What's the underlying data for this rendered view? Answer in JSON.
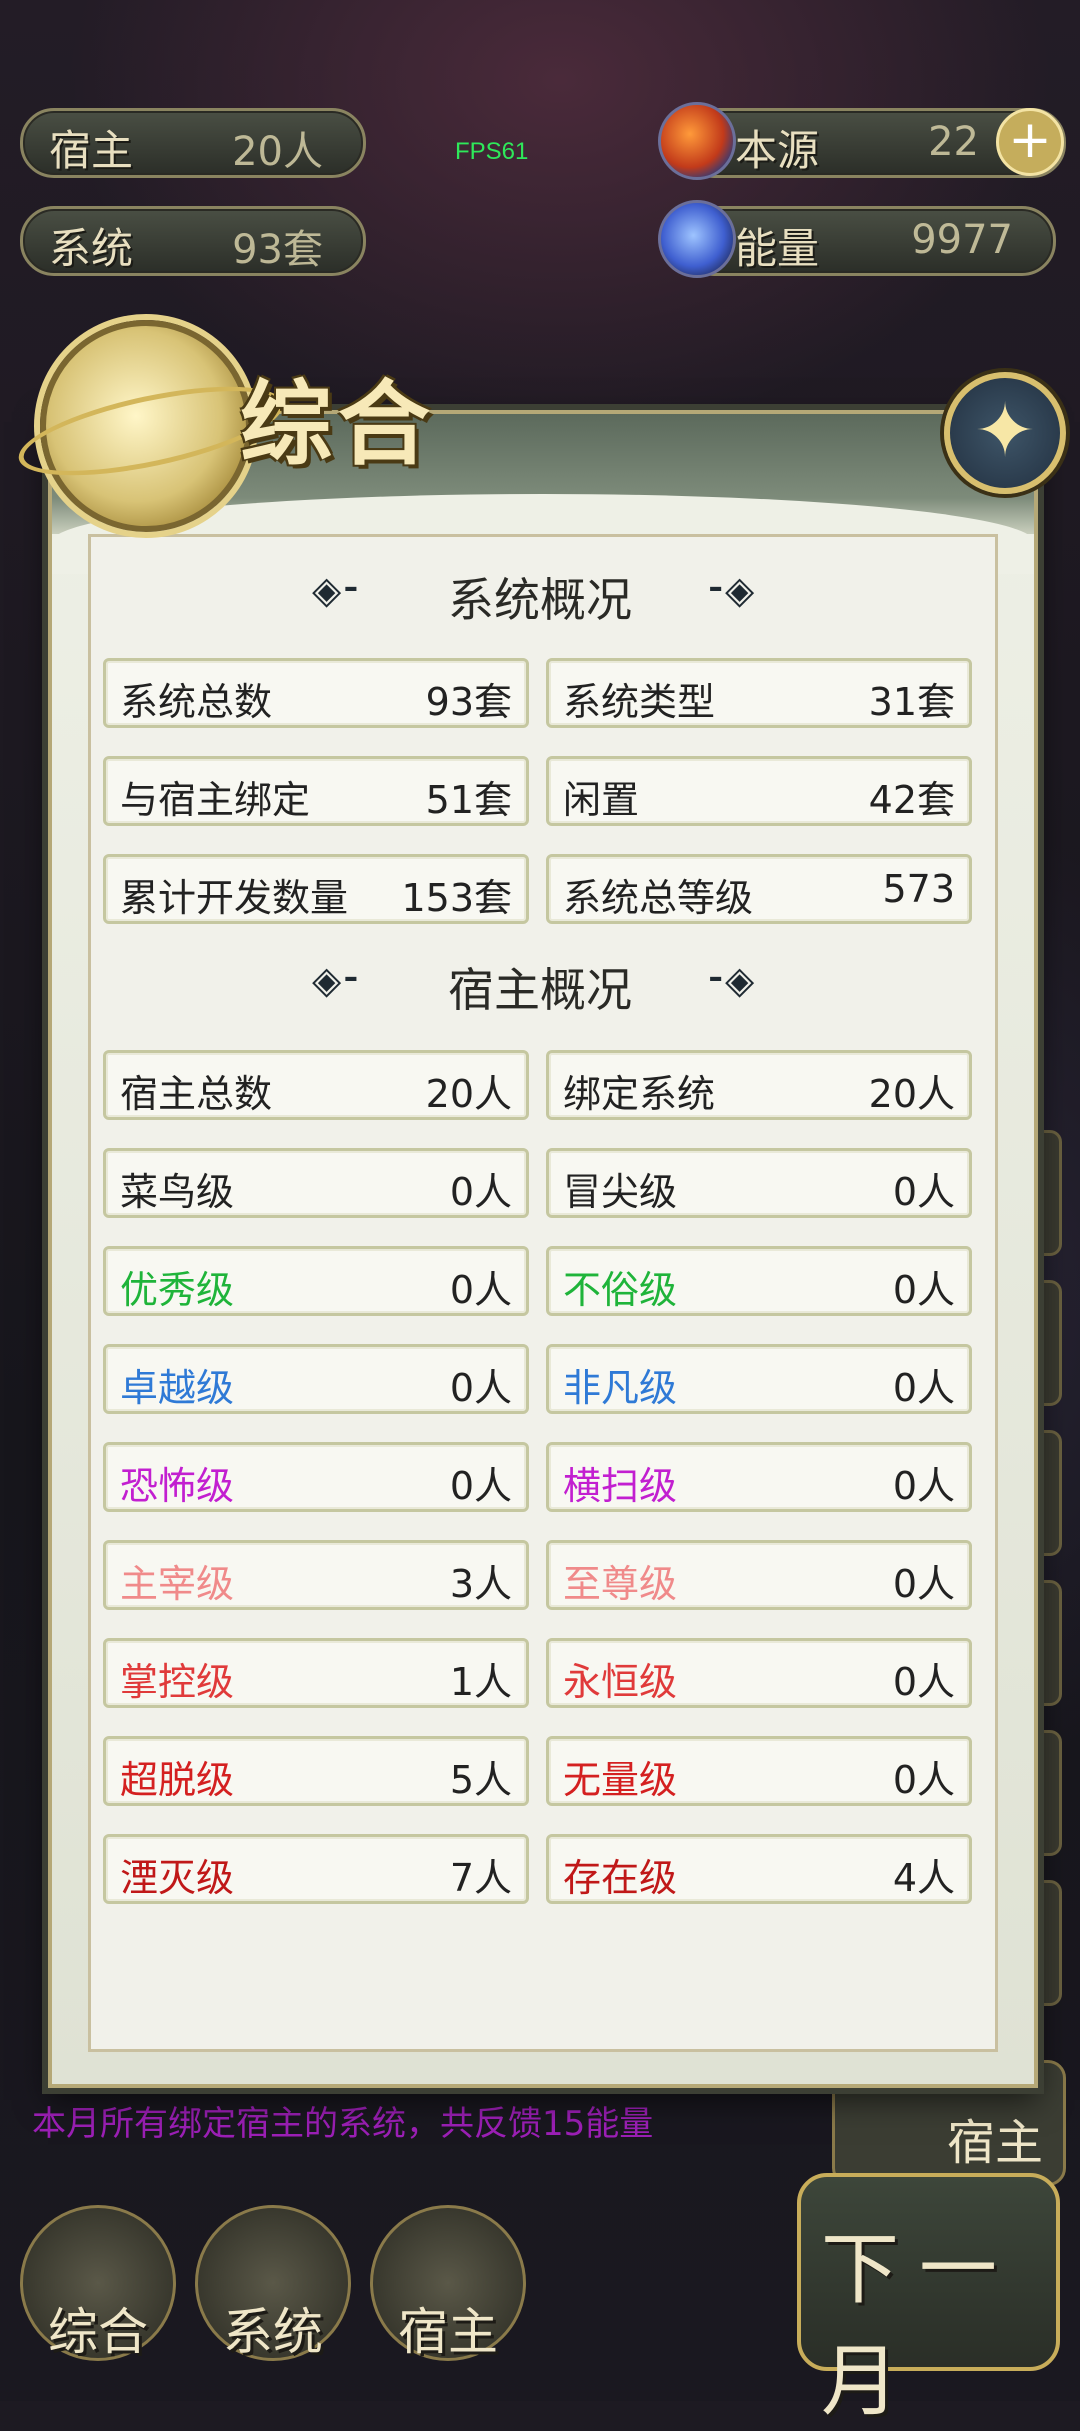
{
  "hud": {
    "host_label": "宿主",
    "host_value": "20人",
    "system_label": "系统",
    "system_value": "93套",
    "source_label": "本源",
    "source_value": "22",
    "energy_label": "能量",
    "energy_value": "9977",
    "fps": "FPS61",
    "plus_icon": "+"
  },
  "modal": {
    "title": "综合",
    "close_icon": "✦",
    "system_section": "系统概况",
    "host_section": "宿主概况",
    "deco_left": "◈⁃",
    "deco_right": "⁃◈",
    "system_stats": [
      {
        "k": "系统总数",
        "v": "93套"
      },
      {
        "k": "系统类型",
        "v": "31套"
      },
      {
        "k": "与宿主绑定",
        "v": "51套"
      },
      {
        "k": "闲置",
        "v": "42套"
      },
      {
        "k": "累计开发数量",
        "v": "153套"
      },
      {
        "k": "系统总等级",
        "v": "573"
      }
    ],
    "host_stats": [
      {
        "k": "宿主总数",
        "v": "20人",
        "color": "#222222"
      },
      {
        "k": "绑定系统",
        "v": "20人",
        "color": "#222222"
      },
      {
        "k": "菜鸟级",
        "v": "0人",
        "color": "#222222"
      },
      {
        "k": "冒尖级",
        "v": "0人",
        "color": "#222222"
      },
      {
        "k": "优秀级",
        "v": "0人",
        "color": "#1fb43a"
      },
      {
        "k": "不俗级",
        "v": "0人",
        "color": "#1fb43a"
      },
      {
        "k": "卓越级",
        "v": "0人",
        "color": "#2f7ad6"
      },
      {
        "k": "非凡级",
        "v": "0人",
        "color": "#2f7ad6"
      },
      {
        "k": "恐怖级",
        "v": "0人",
        "color": "#c21fd0"
      },
      {
        "k": "横扫级",
        "v": "0人",
        "color": "#c21fd0"
      },
      {
        "k": "主宰级",
        "v": "3人",
        "color": "#f08a8a"
      },
      {
        "k": "至尊级",
        "v": "0人",
        "color": "#f08a8a"
      },
      {
        "k": "掌控级",
        "v": "1人",
        "color": "#e03a3a"
      },
      {
        "k": "永恒级",
        "v": "0人",
        "color": "#e03a3a"
      },
      {
        "k": "超脱级",
        "v": "5人",
        "color": "#d42020"
      },
      {
        "k": "无量级",
        "v": "0人",
        "color": "#d42020"
      },
      {
        "k": "湮灭级",
        "v": "7人",
        "color": "#c01818"
      },
      {
        "k": "存在级",
        "v": "4人",
        "color": "#c01818"
      }
    ]
  },
  "background": {
    "ticker": "本月所有绑定宿主的系统，共反馈15能量",
    "find_host": "宿主",
    "nav": [
      "综合",
      "系统",
      "宿主"
    ],
    "next_month": "下一月"
  }
}
